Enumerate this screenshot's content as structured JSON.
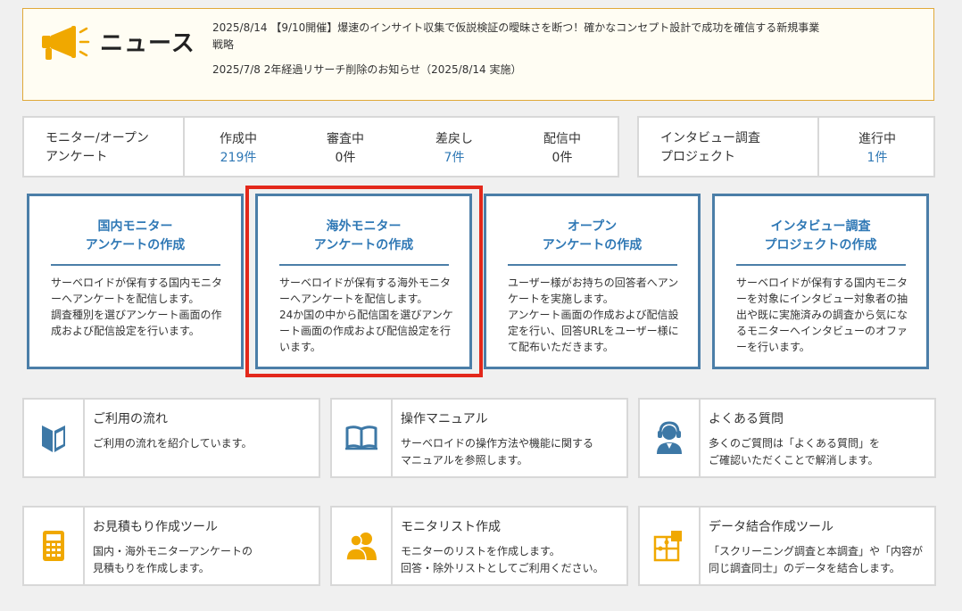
{
  "news": {
    "title": "ニュース",
    "items": [
      {
        "date": "2025/8/14",
        "text": "【9/10開催】爆速のインサイト収集で仮説検証の曖昧さを断つ！確かなコンセプト設計で成功を確信する新規事業戦略"
      },
      {
        "date": "2025/7/8",
        "text": "2年経過リサーチ削除のお知らせ（2025/8/14 実施）"
      }
    ]
  },
  "survey_stats": {
    "label_line1": "モニター/オープン",
    "label_line2": "アンケート",
    "columns": [
      {
        "label": "作成中",
        "value": "219件",
        "link": true
      },
      {
        "label": "審査中",
        "value": "0件",
        "link": false
      },
      {
        "label": "差戻し",
        "value": "7件",
        "link": true
      },
      {
        "label": "配信中",
        "value": "0件",
        "link": false
      }
    ]
  },
  "interview_stats": {
    "label_line1": "インタビュー調査",
    "label_line2": "プロジェクト",
    "columns": [
      {
        "label": "進行中",
        "value": "1件",
        "link": true
      }
    ]
  },
  "cards": [
    {
      "title1": "国内モニター",
      "title2": "アンケートの作成",
      "desc": "サーベロイドが保有する国内モニターへアンケートを配信します。\n調査種別を選びアンケート画面の作成および配信設定を行います。"
    },
    {
      "title1": "海外モニター",
      "title2": "アンケートの作成",
      "desc": "サーベロイドが保有する海外モニターへアンケートを配信します。\n24か国の中から配信国を選びアンケート画面の作成および配信設定を行います。"
    },
    {
      "title1": "オープン",
      "title2": "アンケートの作成",
      "desc": "ユーザー様がお持ちの回答者へアンケートを実施します。\nアンケート画面の作成および配信設定を行い、回答URLをユーザー様にて配布いただきます。"
    },
    {
      "title1": "インタビュー調査",
      "title2": "プロジェクトの作成",
      "desc": "サーベロイドが保有する国内モニターを対象にインタビュー対象者の抽出や既に実施済みの調査から気になるモニターへインタビューのオファーを行います。"
    }
  ],
  "tiles": [
    {
      "title": "ご利用の流れ",
      "desc": "ご利用の流れを紹介しています。",
      "icon": "beginner-mark-icon",
      "color": "#3d78a6"
    },
    {
      "title": "操作マニュアル",
      "desc": "サーベロイドの操作方法や機能に関する\nマニュアルを参照します。",
      "icon": "book-icon",
      "color": "#3d78a6"
    },
    {
      "title": "よくある質問",
      "desc": "多くのご質問は「よくある質問」を\nご確認いただくことで解消します。",
      "icon": "support-operator-icon",
      "color": "#3d78a6"
    },
    {
      "title": "お見積もり作成ツール",
      "desc": "国内・海外モニターアンケートの\n見積もりを作成します。",
      "icon": "calculator-icon",
      "color": "#f0a800"
    },
    {
      "title": "モニタリスト作成",
      "desc": "モニターのリストを作成します。\n回答・除外リストとしてご利用ください。",
      "icon": "users-icon",
      "color": "#f0a800"
    },
    {
      "title": "データ結合作成ツール",
      "desc": "「スクリーニング調査と本調査」や「内容が\n同じ調査同士」のデータを結合します。",
      "icon": "puzzle-icon",
      "color": "#f0a800"
    }
  ]
}
